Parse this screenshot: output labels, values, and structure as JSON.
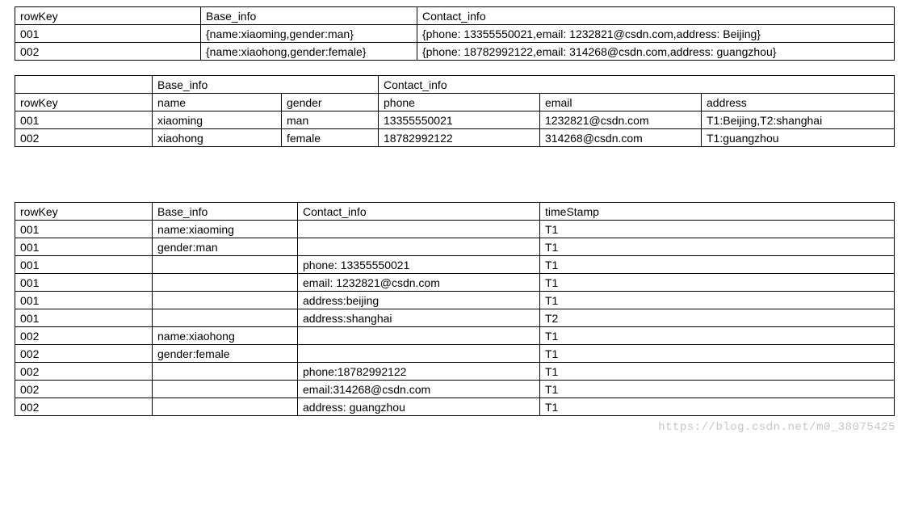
{
  "watermark": "https://blog.csdn.net/m0_38075425",
  "table1": {
    "headers": [
      "rowKey",
      "Base_info",
      "Contact_info"
    ],
    "rows": [
      [
        "001",
        "{name:xiaoming,gender:man}",
        "{phone: 13355550021,email: 1232821@csdn.com,address: Beijing}"
      ],
      [
        "002",
        "{name:xiaohong,gender:female}",
        "{phone: 18782992122,email: 314268@csdn.com,address: guangzhou}"
      ]
    ]
  },
  "table2": {
    "topHeaders": [
      "",
      "Base_info",
      "Contact_info"
    ],
    "subHeaders": [
      "rowKey",
      "name",
      "gender",
      "phone",
      "email",
      "address"
    ],
    "rows": [
      [
        "001",
        "xiaoming",
        "man",
        "13355550021",
        "1232821@csdn.com",
        "T1:Beijing,T2:shanghai"
      ],
      [
        "002",
        "xiaohong",
        "female",
        "18782992122",
        "314268@csdn.com",
        "T1:guangzhou"
      ]
    ]
  },
  "table3": {
    "headers": [
      "rowKey",
      "Base_info",
      "Contact_info",
      "timeStamp"
    ],
    "rows": [
      [
        "001",
        "name:xiaoming",
        "",
        "T1"
      ],
      [
        "001",
        "gender:man",
        "",
        "T1"
      ],
      [
        "001",
        "",
        "phone: 13355550021",
        "T1"
      ],
      [
        "001",
        "",
        "email: 1232821@csdn.com",
        "T1"
      ],
      [
        "001",
        "",
        "address:beijing",
        "T1"
      ],
      [
        "001",
        "",
        "address:shanghai",
        "T2"
      ],
      [
        "002",
        "name:xiaohong",
        "",
        "T1"
      ],
      [
        "002",
        "gender:female",
        "",
        "T1"
      ],
      [
        "002",
        "",
        "phone:18782992122",
        "T1"
      ],
      [
        "002",
        "",
        "email:314268@csdn.com",
        "T1"
      ],
      [
        "002",
        "",
        "address: guangzhou",
        "T1"
      ]
    ]
  }
}
